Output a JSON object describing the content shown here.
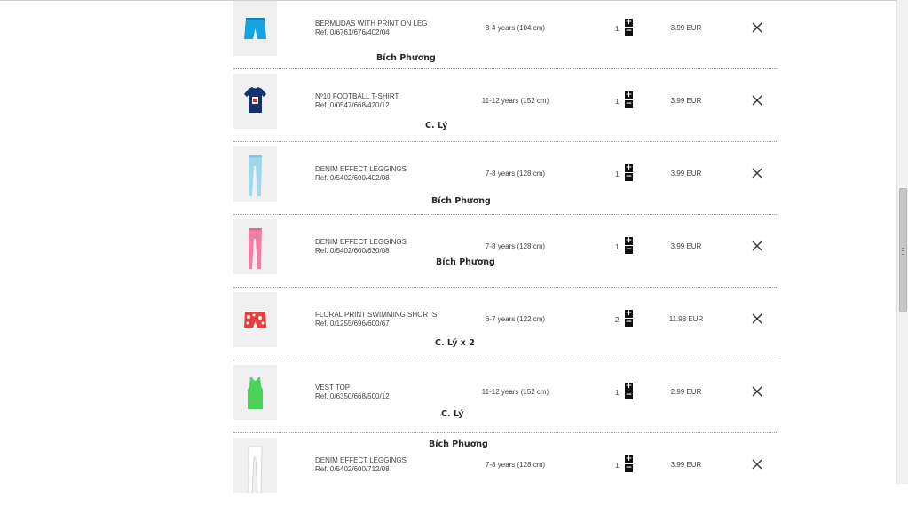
{
  "cart": {
    "items": [
      {
        "name": "BERMUDAS WITH PRINT ON LEG",
        "ref": "Ref. 0/6761/676/402/04",
        "size": "3-4 years (104 cm)",
        "qty": "1",
        "price": "3.99 EUR",
        "note": "Bích Phương",
        "thumb_icon": "blue-bermuda-shorts-image",
        "thumb_color": "#17a3df"
      },
      {
        "name": "Nº10 FOOTBALL T-SHIRT",
        "ref": "Ref. 0/0547/668/420/12",
        "size": "11-12 years (152 cm)",
        "qty": "1",
        "price": "3.99 EUR",
        "note": "C. Lý",
        "thumb_icon": "navy-football-tshirt-image",
        "thumb_color": "#15316b"
      },
      {
        "name": "DENIM EFFECT LEGGINGS",
        "ref": "Ref. 0/5402/600/402/08",
        "size": "7-8 years (128 cm)",
        "qty": "1",
        "price": "3.99 EUR",
        "note": "Bích Phương",
        "thumb_icon": "light-blue-leggings-image",
        "thumb_color": "#9fd8ea"
      },
      {
        "name": "DENIM EFFECT LEGGINGS",
        "ref": "Ref. 0/5402/600/630/08",
        "size": "7-8 years (128 cm)",
        "qty": "1",
        "price": "3.99 EUR",
        "note": "Bích Phương",
        "thumb_icon": "pink-leggings-image",
        "thumb_color": "#f17fa3"
      },
      {
        "name": "FLORAL PRINT SWIMMING SHORTS",
        "ref": "Ref. 0/1255/696/600/67",
        "size": "6-7 years (122 cm)",
        "qty": "2",
        "price": "11.98 EUR",
        "note": "C. Lý x 2",
        "thumb_icon": "floral-swim-shorts-image",
        "thumb_color": "#e2403f"
      },
      {
        "name": "VEST TOP",
        "ref": "Ref. 0/6350/668/500/12",
        "size": "11-12 years (152 cm)",
        "qty": "1",
        "price": "2.99 EUR",
        "note": "C. Lý",
        "thumb_icon": "green-vest-top-image",
        "thumb_color": "#4cd45a"
      },
      {
        "name": "DENIM EFFECT LEGGINGS",
        "ref": "Ref. 0/5402/600/712/08",
        "size": "7-8 years (128 cm)",
        "qty": "1",
        "price": "3.99 EUR",
        "note": "Bích Phương",
        "thumb_icon": "white-leggings-image",
        "thumb_color": "#e6e6e6"
      }
    ],
    "plus_glyph": "+",
    "minus_glyph": "−",
    "remove_icon": "close-x-icon"
  },
  "scrollbar": {
    "position_fraction": 0.33
  }
}
